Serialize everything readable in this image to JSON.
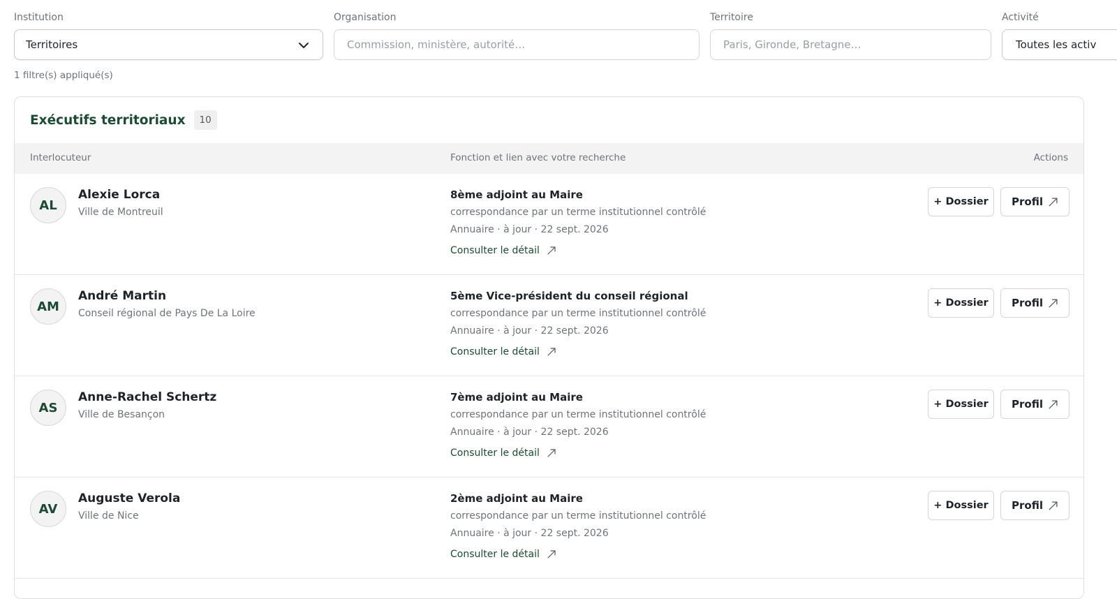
{
  "filters": {
    "institution": {
      "label": "Institution",
      "value": "Territoires"
    },
    "organisation": {
      "label": "Organisation",
      "placeholder": "Commission, ministère, autorité…"
    },
    "territoire": {
      "label": "Territoire",
      "placeholder": "Paris, Gironde, Bretagne…"
    },
    "activite": {
      "label": "Activité",
      "value": "Toutes les activ"
    },
    "applied_text": "1 filtre(s) appliqué(s)"
  },
  "results": {
    "title": "Exécutifs territoriaux",
    "count": "10",
    "columns": {
      "interlocutor": "Interlocuteur",
      "function": "Fonction et lien avec votre recherche",
      "actions": "Actions"
    },
    "buttons": {
      "dossier": "+ Dossier",
      "profil": "Profil",
      "detail": "Consulter le détail"
    },
    "rows": [
      {
        "initials": "AL",
        "name": "Alexie Lorca",
        "org": "Ville de Montreuil",
        "function": "8ème adjoint au Maire",
        "match": "correspondance par un terme institutionnel contrôlé",
        "meta": "Annuaire · à jour · 22 sept. 2026"
      },
      {
        "initials": "AM",
        "name": "André Martin",
        "org": "Conseil régional de Pays De La Loire",
        "function": "5ème Vice-président du conseil régional",
        "match": "correspondance par un terme institutionnel contrôlé",
        "meta": "Annuaire · à jour · 22 sept. 2026"
      },
      {
        "initials": "AS",
        "name": "Anne-Rachel Schertz",
        "org": "Ville de Besançon",
        "function": "7ème adjoint au Maire",
        "match": "correspondance par un terme institutionnel contrôlé",
        "meta": "Annuaire · à jour · 22 sept. 2026"
      },
      {
        "initials": "AV",
        "name": "Auguste Verola",
        "org": "Ville de Nice",
        "function": "2ème adjoint au Maire",
        "match": "correspondance par un terme institutionnel contrôlé",
        "meta": "Annuaire · à jour · 22 sept. 2026"
      }
    ]
  },
  "icons": {
    "dropdown": "chevron-down-icon",
    "external": "arrow-up-right-icon"
  },
  "colors": {
    "accent": "#1d4a34",
    "muted": "#6f7378",
    "header_bg": "#f3f3f3",
    "border": "#d3d6d8"
  }
}
